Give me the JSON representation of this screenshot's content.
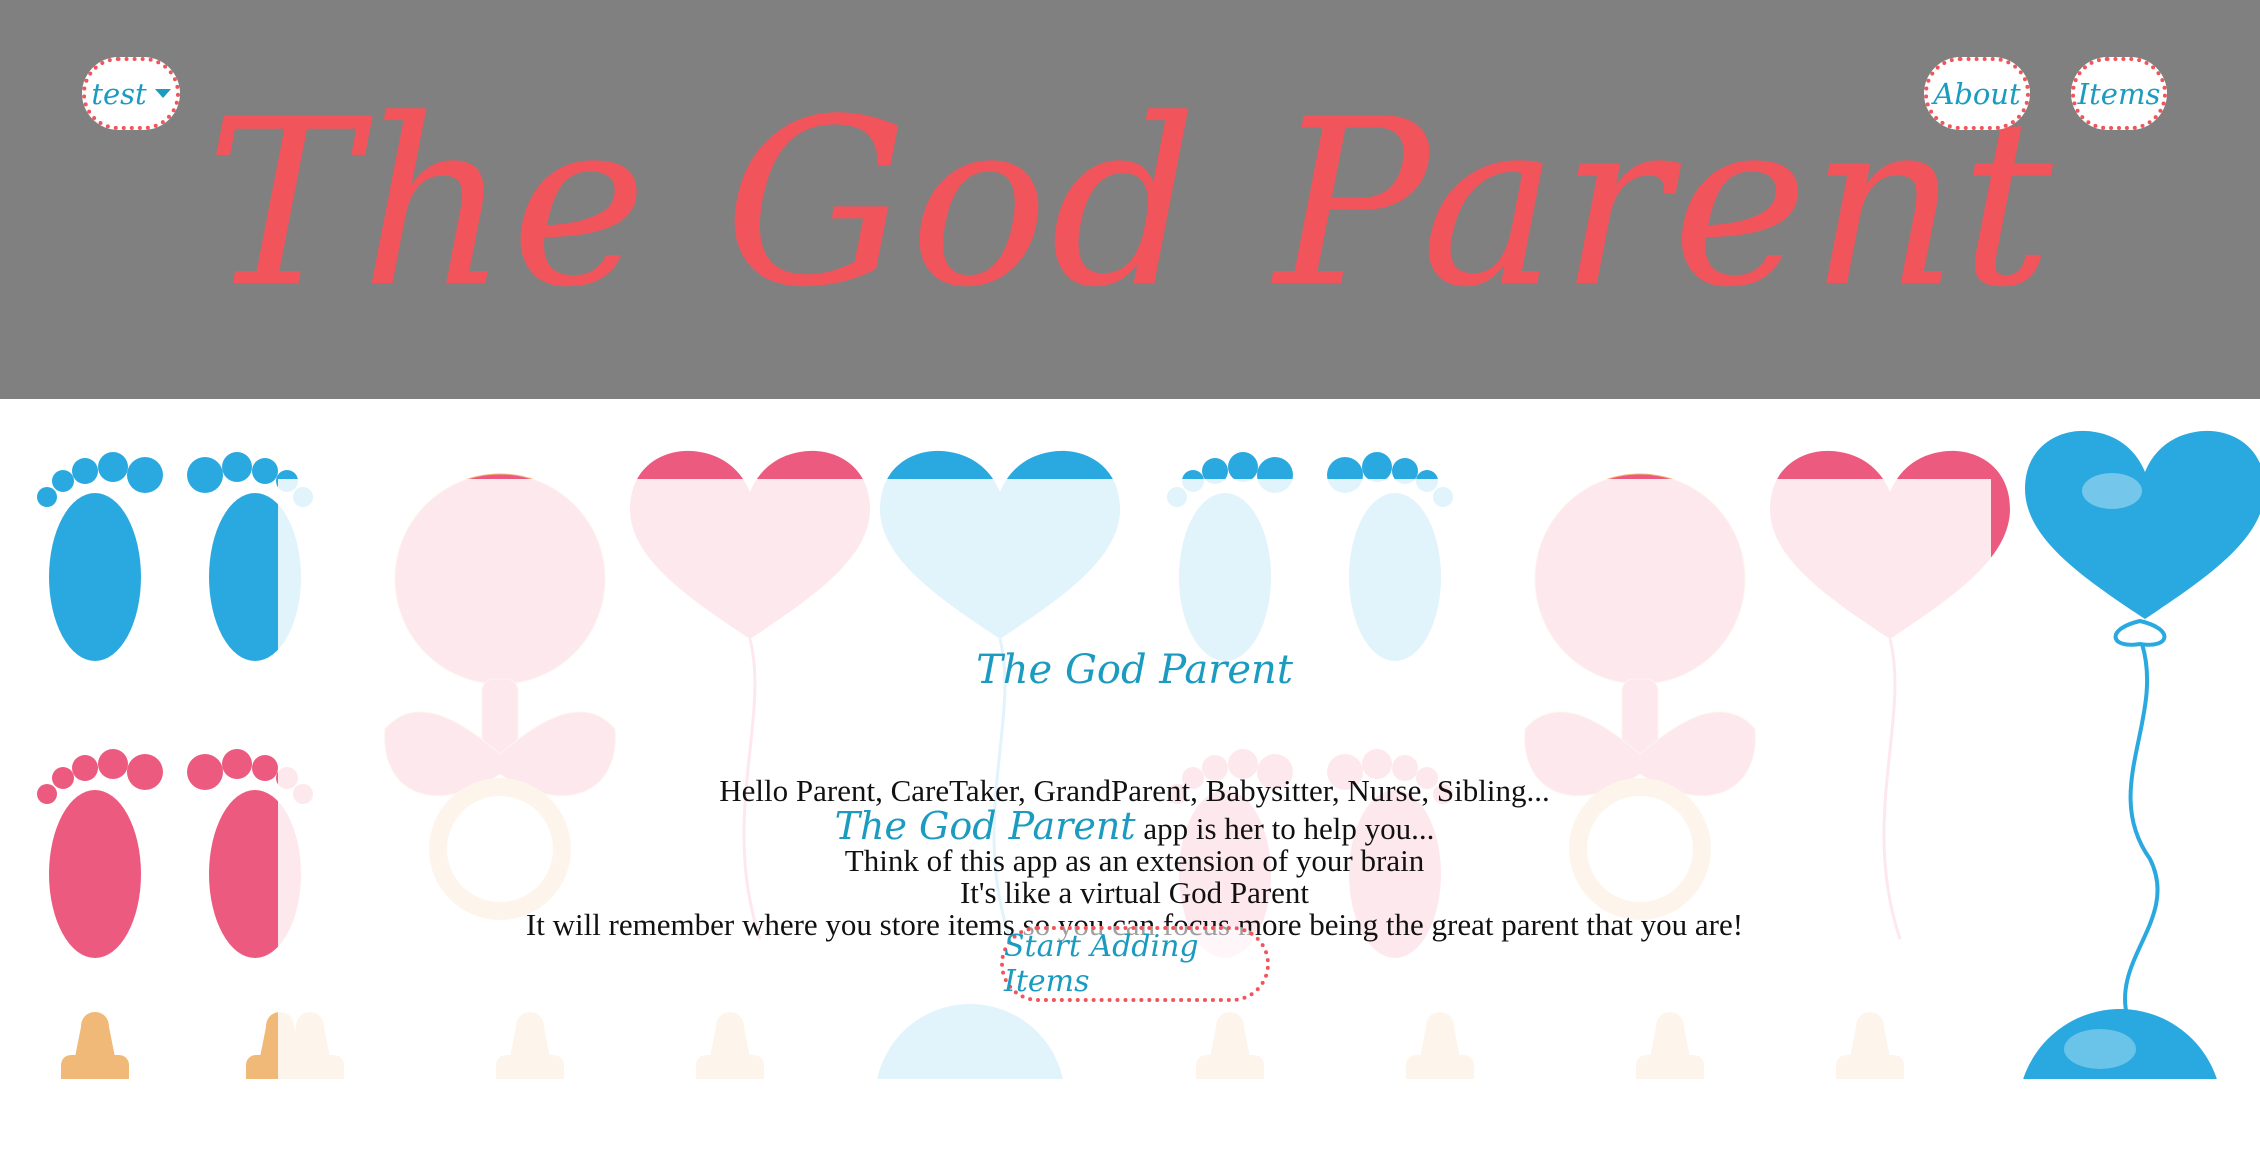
{
  "header": {
    "title": "The God Parent",
    "user_menu_label": "test",
    "nav": {
      "about_label": "About",
      "items_label": "Items"
    }
  },
  "main": {
    "heading": "The God Parent",
    "intro": {
      "line1": "Hello Parent, CareTaker, GrandParent, Babysitter, Nurse, Sibling...",
      "line2_brand": "The God Parent",
      "line2_rest": " app is her to help you...",
      "line3": "Think of this app as an extension of your brain",
      "line4": "It's like a virtual God Parent",
      "line5": "It will remember where you store items so you can focus more being the great parent that you are!"
    },
    "cta_label": "Start Adding Items"
  },
  "icons": [
    "caret-down-icon",
    "baby-feet-icon",
    "heart-balloon-icon",
    "baby-rattle-icon",
    "baby-bottle-icon",
    "round-balloon-icon"
  ],
  "colors": {
    "header_bg": "#808080",
    "title": "#f2545b",
    "accent": "#1a9bbf",
    "border_dotted": "#f2545b",
    "pink": "#ec5a7f",
    "blue": "#2aa9e0"
  }
}
